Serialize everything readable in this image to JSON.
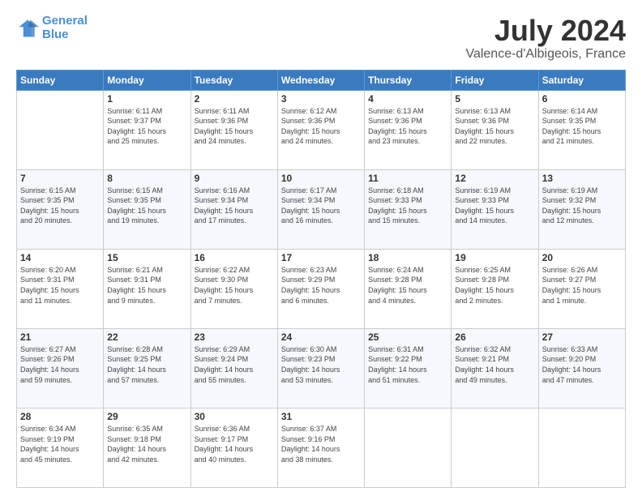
{
  "header": {
    "logo_line1": "General",
    "logo_line2": "Blue",
    "main_title": "July 2024",
    "subtitle": "Valence-d'Albigeois, France"
  },
  "days_of_week": [
    "Sunday",
    "Monday",
    "Tuesday",
    "Wednesday",
    "Thursday",
    "Friday",
    "Saturday"
  ],
  "weeks": [
    [
      {
        "day": "",
        "info": ""
      },
      {
        "day": "1",
        "info": "Sunrise: 6:11 AM\nSunset: 9:37 PM\nDaylight: 15 hours\nand 25 minutes."
      },
      {
        "day": "2",
        "info": "Sunrise: 6:11 AM\nSunset: 9:36 PM\nDaylight: 15 hours\nand 24 minutes."
      },
      {
        "day": "3",
        "info": "Sunrise: 6:12 AM\nSunset: 9:36 PM\nDaylight: 15 hours\nand 24 minutes."
      },
      {
        "day": "4",
        "info": "Sunrise: 6:13 AM\nSunset: 9:36 PM\nDaylight: 15 hours\nand 23 minutes."
      },
      {
        "day": "5",
        "info": "Sunrise: 6:13 AM\nSunset: 9:36 PM\nDaylight: 15 hours\nand 22 minutes."
      },
      {
        "day": "6",
        "info": "Sunrise: 6:14 AM\nSunset: 9:35 PM\nDaylight: 15 hours\nand 21 minutes."
      }
    ],
    [
      {
        "day": "7",
        "info": "Sunrise: 6:15 AM\nSunset: 9:35 PM\nDaylight: 15 hours\nand 20 minutes."
      },
      {
        "day": "8",
        "info": "Sunrise: 6:15 AM\nSunset: 9:35 PM\nDaylight: 15 hours\nand 19 minutes."
      },
      {
        "day": "9",
        "info": "Sunrise: 6:16 AM\nSunset: 9:34 PM\nDaylight: 15 hours\nand 17 minutes."
      },
      {
        "day": "10",
        "info": "Sunrise: 6:17 AM\nSunset: 9:34 PM\nDaylight: 15 hours\nand 16 minutes."
      },
      {
        "day": "11",
        "info": "Sunrise: 6:18 AM\nSunset: 9:33 PM\nDaylight: 15 hours\nand 15 minutes."
      },
      {
        "day": "12",
        "info": "Sunrise: 6:19 AM\nSunset: 9:33 PM\nDaylight: 15 hours\nand 14 minutes."
      },
      {
        "day": "13",
        "info": "Sunrise: 6:19 AM\nSunset: 9:32 PM\nDaylight: 15 hours\nand 12 minutes."
      }
    ],
    [
      {
        "day": "14",
        "info": "Sunrise: 6:20 AM\nSunset: 9:31 PM\nDaylight: 15 hours\nand 11 minutes."
      },
      {
        "day": "15",
        "info": "Sunrise: 6:21 AM\nSunset: 9:31 PM\nDaylight: 15 hours\nand 9 minutes."
      },
      {
        "day": "16",
        "info": "Sunrise: 6:22 AM\nSunset: 9:30 PM\nDaylight: 15 hours\nand 7 minutes."
      },
      {
        "day": "17",
        "info": "Sunrise: 6:23 AM\nSunset: 9:29 PM\nDaylight: 15 hours\nand 6 minutes."
      },
      {
        "day": "18",
        "info": "Sunrise: 6:24 AM\nSunset: 9:28 PM\nDaylight: 15 hours\nand 4 minutes."
      },
      {
        "day": "19",
        "info": "Sunrise: 6:25 AM\nSunset: 9:28 PM\nDaylight: 15 hours\nand 2 minutes."
      },
      {
        "day": "20",
        "info": "Sunrise: 6:26 AM\nSunset: 9:27 PM\nDaylight: 15 hours\nand 1 minute."
      }
    ],
    [
      {
        "day": "21",
        "info": "Sunrise: 6:27 AM\nSunset: 9:26 PM\nDaylight: 14 hours\nand 59 minutes."
      },
      {
        "day": "22",
        "info": "Sunrise: 6:28 AM\nSunset: 9:25 PM\nDaylight: 14 hours\nand 57 minutes."
      },
      {
        "day": "23",
        "info": "Sunrise: 6:29 AM\nSunset: 9:24 PM\nDaylight: 14 hours\nand 55 minutes."
      },
      {
        "day": "24",
        "info": "Sunrise: 6:30 AM\nSunset: 9:23 PM\nDaylight: 14 hours\nand 53 minutes."
      },
      {
        "day": "25",
        "info": "Sunrise: 6:31 AM\nSunset: 9:22 PM\nDaylight: 14 hours\nand 51 minutes."
      },
      {
        "day": "26",
        "info": "Sunrise: 6:32 AM\nSunset: 9:21 PM\nDaylight: 14 hours\nand 49 minutes."
      },
      {
        "day": "27",
        "info": "Sunrise: 6:33 AM\nSunset: 9:20 PM\nDaylight: 14 hours\nand 47 minutes."
      }
    ],
    [
      {
        "day": "28",
        "info": "Sunrise: 6:34 AM\nSunset: 9:19 PM\nDaylight: 14 hours\nand 45 minutes."
      },
      {
        "day": "29",
        "info": "Sunrise: 6:35 AM\nSunset: 9:18 PM\nDaylight: 14 hours\nand 42 minutes."
      },
      {
        "day": "30",
        "info": "Sunrise: 6:36 AM\nSunset: 9:17 PM\nDaylight: 14 hours\nand 40 minutes."
      },
      {
        "day": "31",
        "info": "Sunrise: 6:37 AM\nSunset: 9:16 PM\nDaylight: 14 hours\nand 38 minutes."
      },
      {
        "day": "",
        "info": ""
      },
      {
        "day": "",
        "info": ""
      },
      {
        "day": "",
        "info": ""
      }
    ]
  ]
}
